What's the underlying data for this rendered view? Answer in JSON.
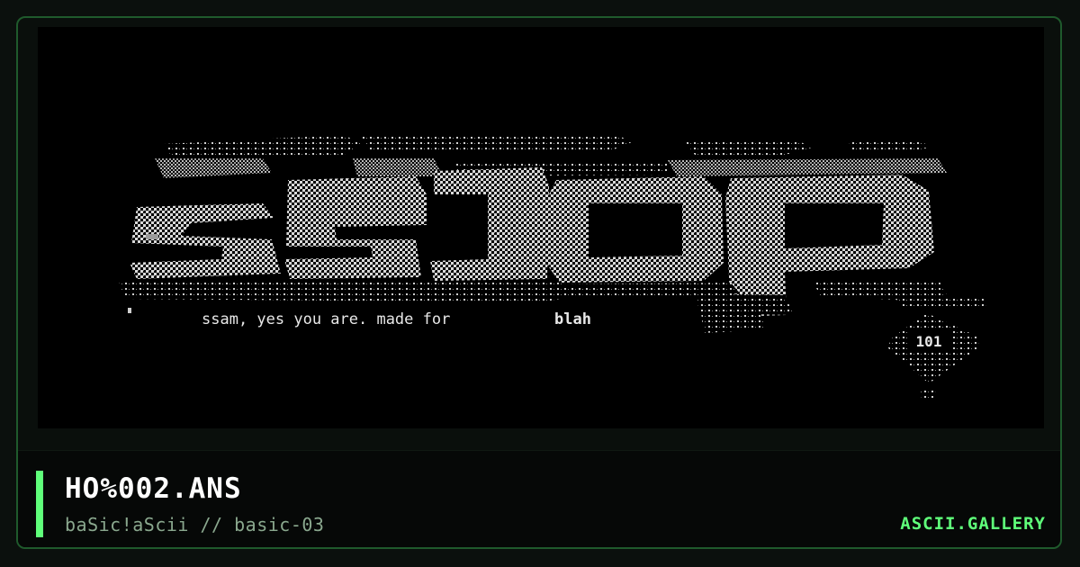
{
  "art": {
    "tagline": "ssam, yes you are. made for",
    "tagline_bold": "blah",
    "badge": "101"
  },
  "caption": {
    "title": "HO%002.ANS",
    "subtitle": "baSic!aScii // basic-03",
    "site": "ASCII.GALLERY"
  },
  "colors": {
    "background": "#0b100d",
    "frame_border": "#1f5a2c",
    "accent": "#5fff7a",
    "art_text": "#e8e8e8"
  }
}
